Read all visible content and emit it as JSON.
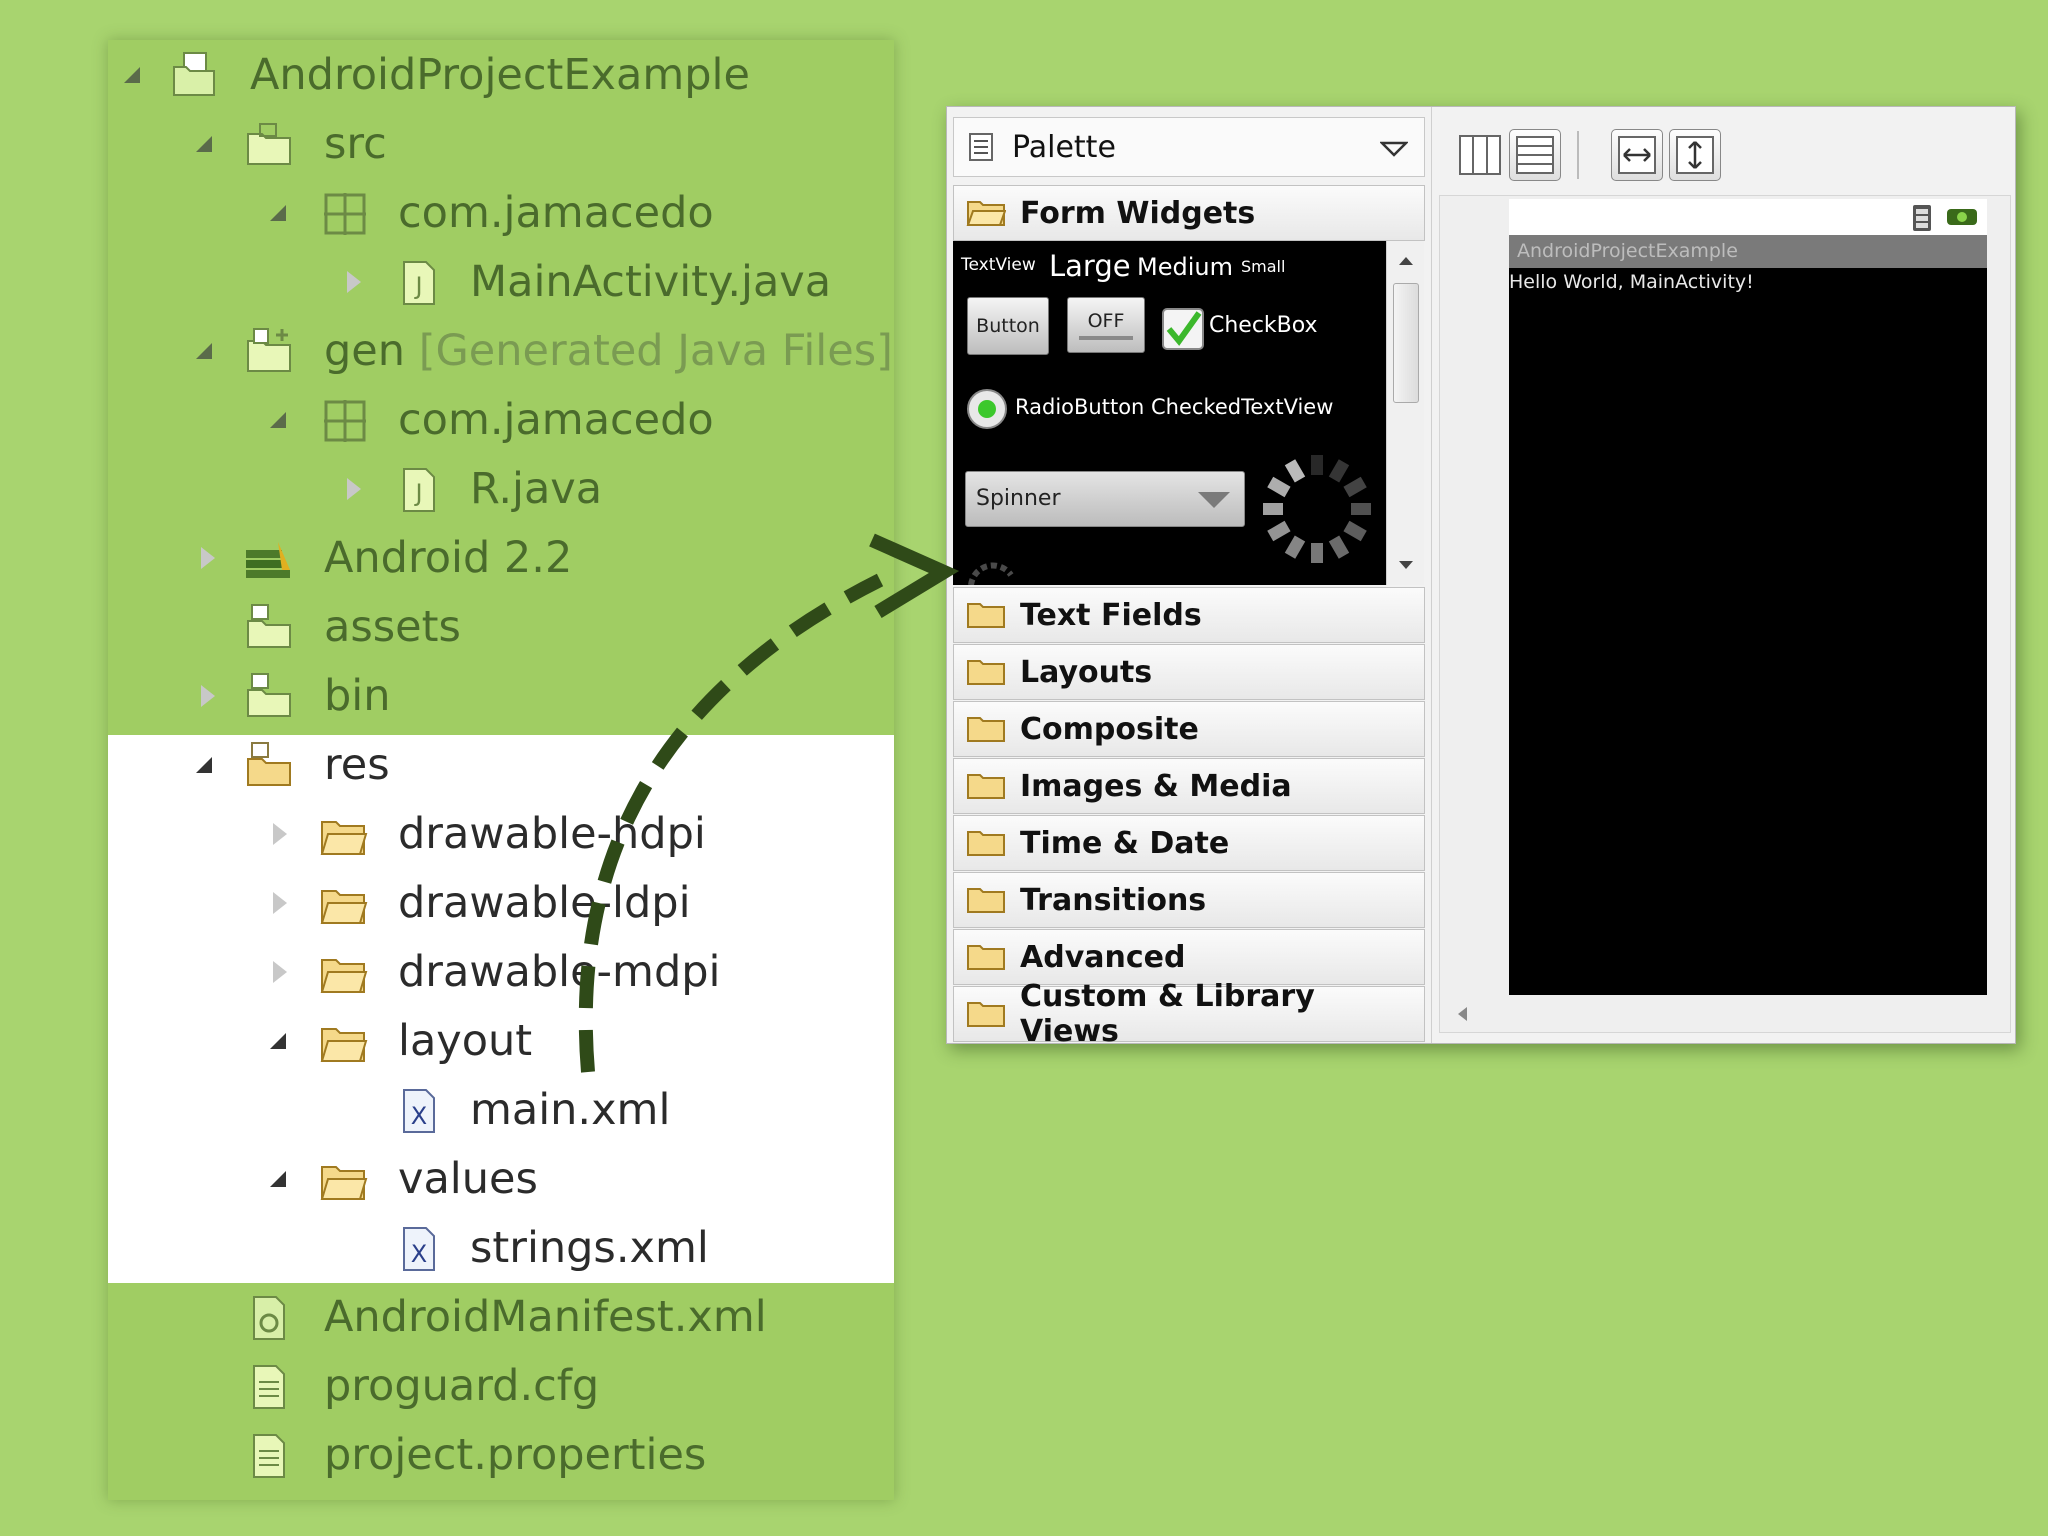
{
  "project_tree": {
    "items": [
      {
        "label": "AndroidProjectExample",
        "icon": "project-folder-icon",
        "state": "expanded"
      },
      {
        "label": "src",
        "icon": "source-folder-icon",
        "state": "expanded"
      },
      {
        "label": "com.jamacedo",
        "icon": "package-icon",
        "state": "expanded"
      },
      {
        "label": "MainActivity.java",
        "icon": "java-file-icon",
        "state": "collapsed"
      },
      {
        "label": "gen",
        "suffix": "[Generated Java Files]",
        "icon": "generated-folder-icon",
        "state": "expanded"
      },
      {
        "label": "com.jamacedo",
        "icon": "package-icon",
        "state": "expanded"
      },
      {
        "label": "R.java",
        "icon": "java-file-icon",
        "state": "collapsed"
      },
      {
        "label": "Android 2.2",
        "icon": "android-library-icon",
        "state": "collapsed"
      },
      {
        "label": "assets",
        "icon": "folder-icon",
        "state": "none"
      },
      {
        "label": "bin",
        "icon": "folder-icon",
        "state": "collapsed"
      },
      {
        "label": "res",
        "icon": "res-folder-icon",
        "state": "expanded"
      },
      {
        "label": "drawable-hdpi",
        "icon": "folder-icon",
        "state": "collapsed"
      },
      {
        "label": "drawable-ldpi",
        "icon": "folder-icon",
        "state": "collapsed"
      },
      {
        "label": "drawable-mdpi",
        "icon": "folder-icon",
        "state": "collapsed"
      },
      {
        "label": "layout",
        "icon": "folder-icon",
        "state": "expanded"
      },
      {
        "label": "main.xml",
        "icon": "xml-file-icon",
        "state": "none"
      },
      {
        "label": "values",
        "icon": "folder-icon",
        "state": "expanded"
      },
      {
        "label": "strings.xml",
        "icon": "xml-file-icon",
        "state": "none"
      },
      {
        "label": "AndroidManifest.xml",
        "icon": "manifest-file-icon",
        "state": "none"
      },
      {
        "label": "proguard.cfg",
        "icon": "text-file-icon",
        "state": "none"
      },
      {
        "label": "project.properties",
        "icon": "text-file-icon",
        "state": "none"
      }
    ]
  },
  "palette": {
    "title": "Palette",
    "categories": {
      "form_widgets": "Form Widgets",
      "text_fields": "Text Fields",
      "layouts": "Layouts",
      "composite": "Composite",
      "images_media": "Images & Media",
      "time_date": "Time & Date",
      "transitions": "Transitions",
      "advanced": "Advanced",
      "custom_library": "Custom & Library Views"
    },
    "widgets": {
      "textview": "TextView",
      "large": "Large",
      "medium": "Medium",
      "small": "Small",
      "button": "Button",
      "toggle": "OFF",
      "checkbox": "CheckBox",
      "radiobutton": "RadioButton",
      "checkedtextview": "CheckedTextView",
      "spinner": "Spinner"
    }
  },
  "device_preview": {
    "app_title": "AndroidProjectExample",
    "hello_text": "Hello World, MainActivity!"
  },
  "colors": {
    "background": "#a8d46f",
    "tree_green": "#a0cd63",
    "arrow": "#2f4a18"
  }
}
